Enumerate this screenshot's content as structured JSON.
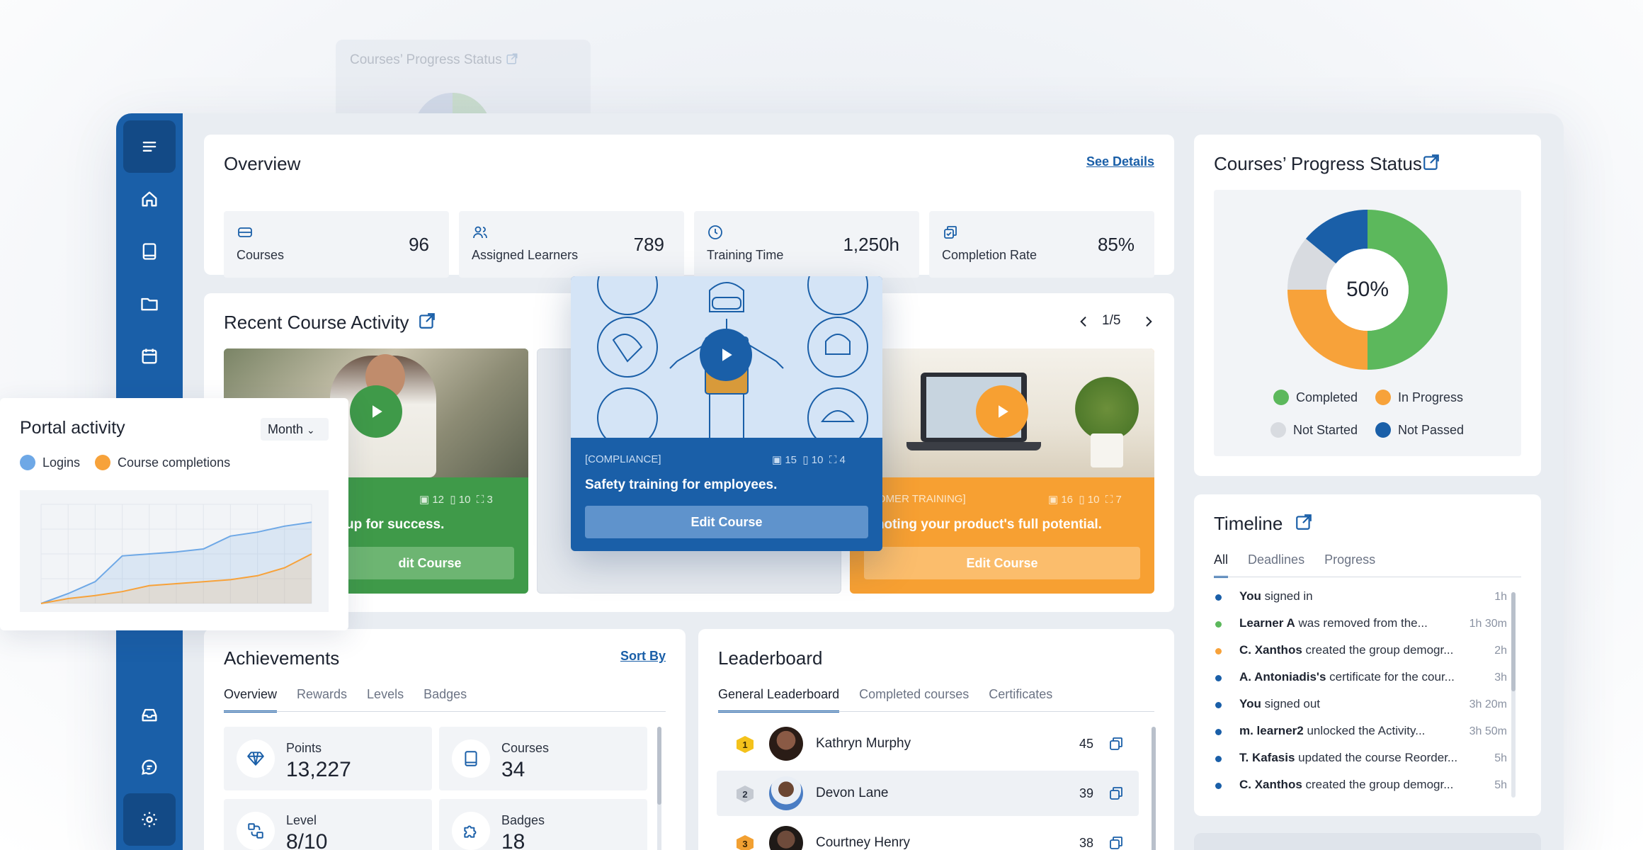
{
  "ghost": {
    "title": "Courses’ Progress Status"
  },
  "overview": {
    "title": "Overview",
    "see_details": "See Details",
    "stats": [
      {
        "label": "Courses",
        "value": "96",
        "icon": "course-icon"
      },
      {
        "label": "Assigned Learners",
        "value": "789",
        "icon": "learners-icon"
      },
      {
        "label": "Training Time",
        "value": "1,250h",
        "icon": "clock-icon"
      },
      {
        "label": "Completion Rate",
        "value": "85%",
        "icon": "completion-icon"
      }
    ]
  },
  "recent": {
    "title": "Recent Course Activity",
    "pager": "1/5",
    "courses": [
      {
        "meta_a": "12",
        "meta_b": "10",
        "meta_c": "3",
        "text": "up for success.",
        "button": "dit Course",
        "color": "#3f9a49"
      },
      {
        "category": "[COMPLIANCE]",
        "meta_a": "15",
        "meta_b": "10",
        "meta_c": "4",
        "text": "Safety training for employees.",
        "button": "Edit Course",
        "color": "#1a5fa8"
      },
      {
        "category": "STOMER TRAINING]",
        "meta_a": "16",
        "meta_b": "10",
        "meta_c": "7",
        "text": "omoting your product's full potential.",
        "button": "Edit Course",
        "color": "#f7a032"
      }
    ]
  },
  "progress_status": {
    "title": "Courses’ Progress Status",
    "center_label": "50%",
    "legend": [
      {
        "label": "Completed",
        "color": "#5cb85c"
      },
      {
        "label": "In Progress",
        "color": "#f7a23a"
      },
      {
        "label": "Not Started",
        "color": "#d8dbe0"
      },
      {
        "label": "Not Passed",
        "color": "#1a5fa8"
      }
    ],
    "chart_data": {
      "type": "pie",
      "categories": [
        "Completed",
        "In Progress",
        "Not Started",
        "Not Passed"
      ],
      "values": [
        50,
        25,
        11,
        14
      ]
    }
  },
  "timeline": {
    "title": "Timeline",
    "tabs": [
      "All",
      "Deadlines",
      "Progress"
    ],
    "items": [
      {
        "actor": "You",
        "action": " signed in",
        "time": "1h",
        "color": "#1a5fa8"
      },
      {
        "actor": "Learner A",
        "action": " was removed from the...",
        "time": "1h 30m",
        "color": "#5cb85c"
      },
      {
        "actor": "C. Xanthos",
        "action": " created the group demogr...",
        "time": "2h",
        "color": "#f7a23a"
      },
      {
        "actor": "A. Antoniadis's",
        "action": " certificate for the cour...",
        "time": "3h",
        "color": "#1a5fa8"
      },
      {
        "actor": "You",
        "action": " signed out",
        "time": "3h 20m",
        "color": "#1a5fa8"
      },
      {
        "actor": "m. learner2",
        "action": " unlocked the Activity...",
        "time": "3h 50m",
        "color": "#1a5fa8"
      },
      {
        "actor": "T. Kafasis",
        "action": " updated the course Reorder...",
        "time": "5h",
        "color": "#1a5fa8"
      },
      {
        "actor": "C. Xanthos",
        "action": " created the group demogr...",
        "time": "5h",
        "color": "#1a5fa8"
      }
    ]
  },
  "achievements": {
    "title": "Achievements",
    "sort": "Sort By",
    "tabs": [
      "Overview",
      "Rewards",
      "Levels",
      "Badges"
    ],
    "items": [
      {
        "label": "Points",
        "value": "13,227",
        "icon": "diamond-icon"
      },
      {
        "label": "Courses",
        "value": "34",
        "icon": "book-icon"
      },
      {
        "label": "Level",
        "value": "8/10",
        "icon": "level-icon"
      },
      {
        "label": "Badges",
        "value": "18",
        "icon": "puzzle-icon"
      }
    ]
  },
  "leaderboard": {
    "title": "Leaderboard",
    "tabs": [
      "General Leaderboard",
      "Completed courses",
      "Certificates"
    ],
    "rows": [
      {
        "rank": "1",
        "name": "Kathryn Murphy",
        "score": "45"
      },
      {
        "rank": "2",
        "name": "Devon Lane",
        "score": "39"
      },
      {
        "rank": "3",
        "name": "Courtney Henry",
        "score": "38"
      }
    ]
  },
  "portal": {
    "title": "Portal activity",
    "period": "Month",
    "legend": [
      {
        "label": "Logins",
        "color": "#6ea8e6"
      },
      {
        "label": "Course completions",
        "color": "#f7a23a"
      }
    ],
    "chart_data": {
      "type": "area",
      "x": [
        1,
        2,
        3,
        4,
        5,
        6,
        7,
        8,
        9,
        10,
        11
      ],
      "series": [
        {
          "name": "Logins",
          "values": [
            0,
            10,
            22,
            48,
            50,
            52,
            55,
            68,
            72,
            78,
            82
          ]
        },
        {
          "name": "Course completions",
          "values": [
            0,
            5,
            8,
            12,
            18,
            20,
            22,
            24,
            28,
            36,
            50
          ]
        }
      ],
      "ylim": [
        0,
        100
      ]
    }
  }
}
